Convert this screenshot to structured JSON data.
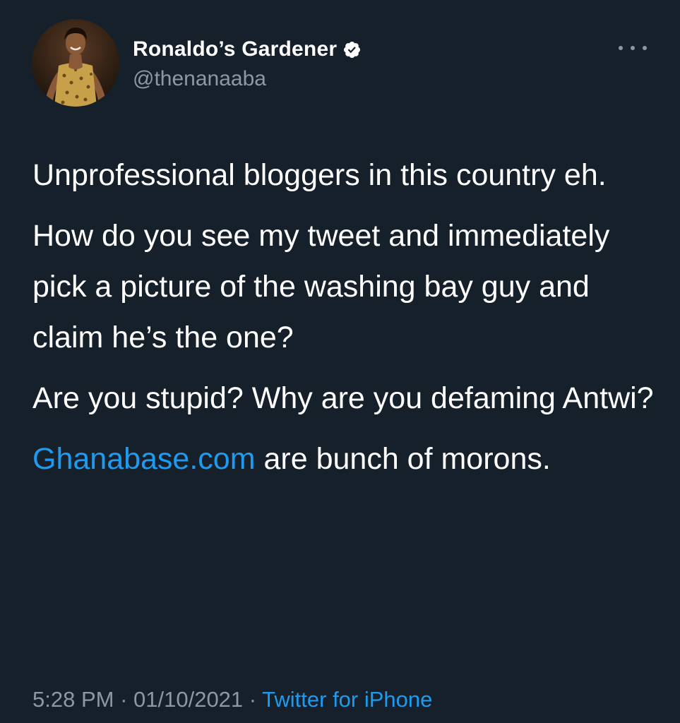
{
  "tweet": {
    "author": {
      "display_name": "Ronaldo’s Gardener",
      "handle": "@thenanaaba",
      "verified": true,
      "avatar_icon": "profile-photo"
    },
    "menu_icon": "more-dots-icon",
    "paragraphs": [
      "Unprofessional bloggers in this country eh.",
      "How do you see my tweet and immediately pick a picture of the washing bay guy and claim he’s the one?",
      "Are you stupid? Why are you defaming Antwi?"
    ],
    "last_paragraph": {
      "link_text": "Ghanabase.com",
      "rest_text": " are bunch of morons."
    },
    "time": "5:28 PM",
    "separator": " · ",
    "date": "01/10/2021",
    "source": "Twitter for iPhone"
  },
  "colors": {
    "background": "#15202b",
    "text": "#ffffff",
    "secondary": "#8b98a5",
    "link": "#1d9bf0"
  }
}
